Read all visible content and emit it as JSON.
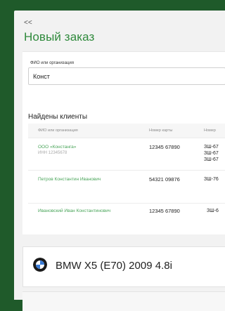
{
  "nav": {
    "back_label": "<<"
  },
  "page_title": "Новый заказ",
  "search": {
    "label": "ФИО или организация",
    "value": "Конст"
  },
  "results": {
    "heading": "Найдены клиенты",
    "columns": [
      "ФИО или организация",
      "Номер карты",
      "Номер"
    ],
    "rows": [
      {
        "name": "ООО «Констанга»",
        "inn": "ИНН 12345678",
        "card": "12345 67890",
        "phones": [
          "ЗШ-67",
          "ЗШ-67",
          "ЗШ-67"
        ]
      },
      {
        "name": "Петров Константин Иванович",
        "inn": "",
        "card": "54321 09876",
        "phones": [
          "ЗШ-76"
        ]
      },
      {
        "name": "Ивановский Иван Константинович",
        "inn": "",
        "card": "12345 67890",
        "phones": [
          "ЗШ-6"
        ]
      }
    ]
  },
  "car": {
    "title": "BMW X5 (E70) 2009 4.8i",
    "brand_icon": "bmw-logo-icon"
  },
  "colors": {
    "frame": "#1f5a2a",
    "accent": "#2f8a3c",
    "link": "#4aa55a"
  }
}
